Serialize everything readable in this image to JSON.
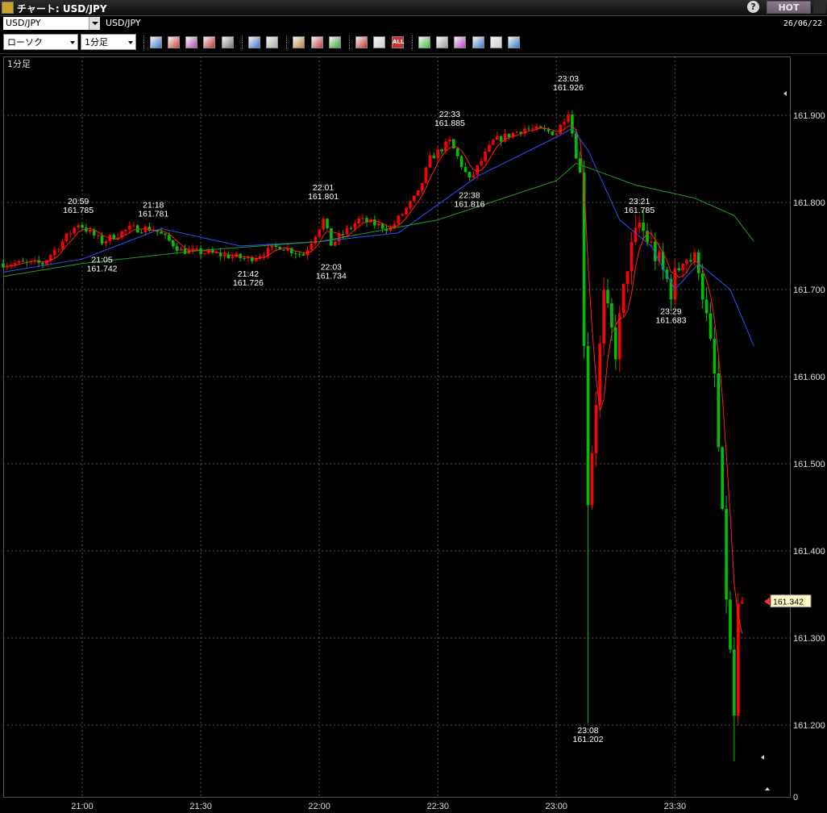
{
  "window": {
    "title": "チャート: USD/JPY",
    "help_label": "?",
    "hot_label": "HOT"
  },
  "header": {
    "symbol_value": "USD/JPY",
    "symbol_label": "USD/JPY",
    "date": "26/06/22"
  },
  "toolbar": {
    "chart_type": "ローソク",
    "timeframe": "1分足",
    "icons": [
      "download-icon",
      "zoom-magnify-icon",
      "grid-icon",
      "compare-icon",
      "disabled-icon",
      "search-icon",
      "crosshair-icon",
      "settings-icon",
      "pencil-icon",
      "color-icon",
      "candle-icon",
      "line-delete-icon",
      "all-icon",
      "trendline-icon",
      "tool-icon",
      "cursor-icon",
      "arrow-icon",
      "notes-icon",
      "trash-icon"
    ],
    "all_label": "ALL"
  },
  "chart_data": {
    "type": "candlestick",
    "timeframe_label": "1分足",
    "ylim": [
      161.11,
      162.03
    ],
    "y_ticks": [
      "161.900",
      "161.800",
      "161.700",
      "161.600",
      "161.500",
      "161.400",
      "161.300",
      "161.200"
    ],
    "bottom_right_tick": "0",
    "x_ticks": [
      "21:00",
      "21:30",
      "22:00",
      "22:30",
      "23:00",
      "23:30"
    ],
    "x_range": [
      "20:40",
      "23:54"
    ],
    "last_price": "161.342",
    "colors": {
      "up": "#ff0000",
      "down": "#00c000",
      "ma_short": "#ff2020",
      "ma_mid": "#3050ff",
      "ma_long": "#20a020",
      "grid": "#555555"
    },
    "anchors": [
      [
        "20:40",
        161.73
      ],
      [
        "20:50",
        161.73
      ],
      [
        "20:59",
        161.776
      ],
      [
        "21:05",
        161.755
      ],
      [
        "21:12",
        161.77
      ],
      [
        "21:18",
        161.77
      ],
      [
        "21:25",
        161.745
      ],
      [
        "21:32",
        161.742
      ],
      [
        "21:42",
        161.735
      ],
      [
        "21:50",
        161.75
      ],
      [
        "21:56",
        161.74
      ],
      [
        "22:01",
        161.78
      ],
      [
        "22:03",
        161.752
      ],
      [
        "22:10",
        161.78
      ],
      [
        "22:18",
        161.77
      ],
      [
        "22:25",
        161.81
      ],
      [
        "22:28",
        161.85
      ],
      [
        "22:33",
        161.87
      ],
      [
        "22:38",
        161.825
      ],
      [
        "22:44",
        161.87
      ],
      [
        "22:52",
        161.885
      ],
      [
        "23:00",
        161.88
      ],
      [
        "23:03",
        161.905
      ],
      [
        "23:06",
        161.83
      ],
      [
        "23:08",
        161.46
      ],
      [
        "23:12",
        161.69
      ],
      [
        "23:15",
        161.63
      ],
      [
        "23:18",
        161.73
      ],
      [
        "23:21",
        161.775
      ],
      [
        "23:25",
        161.74
      ],
      [
        "23:29",
        161.7
      ],
      [
        "23:32",
        161.74
      ],
      [
        "23:36",
        161.73
      ],
      [
        "23:40",
        161.6
      ],
      [
        "23:43",
        161.35
      ],
      [
        "23:45",
        161.21
      ],
      [
        "23:46",
        161.33
      ],
      [
        "23:47",
        161.342
      ]
    ],
    "spikes": [
      [
        "23:08",
        161.202
      ],
      [
        "23:45",
        161.158
      ]
    ],
    "annotations": [
      {
        "time": "20:59",
        "price": "161.785",
        "side": "high"
      },
      {
        "time": "21:05",
        "price": "161.742",
        "side": "low"
      },
      {
        "time": "21:18",
        "price": "161.781",
        "side": "high"
      },
      {
        "time": "21:42",
        "price": "161.726",
        "side": "low"
      },
      {
        "time": "22:01",
        "price": "161.801",
        "side": "high"
      },
      {
        "time": "22:03",
        "price": "161.734",
        "side": "low"
      },
      {
        "time": "22:33",
        "price": "161.885",
        "side": "high"
      },
      {
        "time": "22:38",
        "price": "161.816",
        "side": "low"
      },
      {
        "time": "23:03",
        "price": "161.926",
        "side": "high"
      },
      {
        "time": "23:08",
        "price": "161.202",
        "side": "low"
      },
      {
        "time": "23:21",
        "price": "161.785",
        "side": "high"
      },
      {
        "time": "23:29",
        "price": "161.683",
        "side": "low"
      }
    ],
    "ma_mid": [
      [
        "20:40",
        161.72
      ],
      [
        "21:00",
        161.735
      ],
      [
        "21:20",
        161.77
      ],
      [
        "21:40",
        161.75
      ],
      [
        "22:00",
        161.755
      ],
      [
        "22:20",
        161.765
      ],
      [
        "22:40",
        161.83
      ],
      [
        "23:00",
        161.875
      ],
      [
        "23:04",
        161.885
      ],
      [
        "23:08",
        161.86
      ],
      [
        "23:16",
        161.78
      ],
      [
        "23:24",
        161.75
      ],
      [
        "23:30",
        161.7
      ],
      [
        "23:36",
        161.73
      ],
      [
        "23:44",
        161.7
      ],
      [
        "23:50",
        161.635
      ]
    ],
    "ma_long": [
      [
        "20:40",
        161.715
      ],
      [
        "21:00",
        161.73
      ],
      [
        "21:30",
        161.745
      ],
      [
        "22:00",
        161.755
      ],
      [
        "22:30",
        161.78
      ],
      [
        "23:00",
        161.825
      ],
      [
        "23:05",
        161.845
      ],
      [
        "23:20",
        161.82
      ],
      [
        "23:35",
        161.805
      ],
      [
        "23:45",
        161.785
      ],
      [
        "23:50",
        161.755
      ]
    ]
  }
}
